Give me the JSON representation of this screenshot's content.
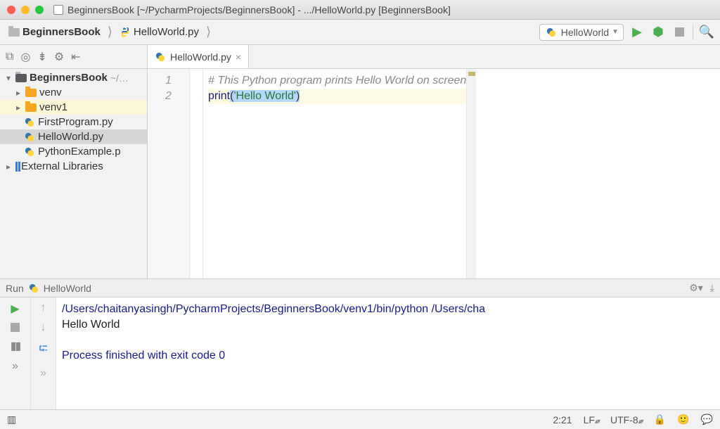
{
  "window": {
    "title": "BeginnersBook [~/PycharmProjects/BeginnersBook] - .../HelloWorld.py [BeginnersBook]"
  },
  "breadcrumbs": [
    {
      "label": "BeginnersBook",
      "kind": "folder"
    },
    {
      "label": "HelloWorld.py",
      "kind": "py"
    }
  ],
  "run_config": {
    "selected": "HelloWorld"
  },
  "project_tree": {
    "root": {
      "name": "BeginnersBook",
      "path_hint": "~/…"
    },
    "items": [
      {
        "label": "venv",
        "kind": "folder"
      },
      {
        "label": "venv1",
        "kind": "folder",
        "state": "expanded_bg"
      },
      {
        "label": "FirstProgram.py",
        "kind": "py"
      },
      {
        "label": "HelloWorld.py",
        "kind": "py",
        "state": "selected"
      },
      {
        "label": "PythonExample.p",
        "kind": "py"
      }
    ],
    "external_libs": "External Libraries"
  },
  "editor": {
    "tab_label": "HelloWorld.py",
    "gutter": [
      "1",
      "2"
    ],
    "code": {
      "line1_comment": "# This Python program prints Hello World on screen",
      "line2_fn": "print",
      "line2_open": "(",
      "line2_str": "'Hello World'",
      "line2_close": ")"
    }
  },
  "run_panel": {
    "label": "Run",
    "config": "HelloWorld",
    "console": {
      "path": "/Users/chaitanyasingh/PycharmProjects/BeginnersBook/venv1/bin/python /Users/cha",
      "output": "Hello World",
      "exit": "Process finished with exit code 0"
    }
  },
  "status": {
    "cursor": "2:21",
    "eol": "LF",
    "encoding": "UTF-8"
  },
  "glyphs": {
    "lock": "🔒",
    "person": "🙂",
    "chat": "💬"
  }
}
